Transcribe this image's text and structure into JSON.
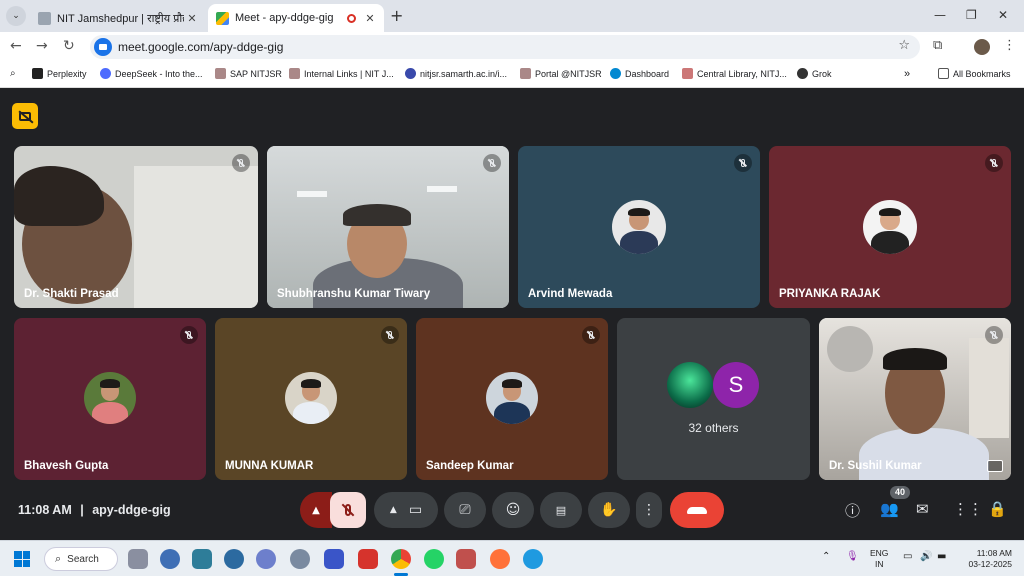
{
  "browser": {
    "tabs": [
      {
        "title": "NIT Jamshedpur | राष्ट्रीय प्रौद्योगिकी",
        "active": false
      },
      {
        "title": "Meet - apy-ddge-gig",
        "active": true
      }
    ],
    "url": "meet.google.com/apy-ddge-gig",
    "bookmarks": [
      "Perplexity",
      "DeepSeek - Into the...",
      "SAP NITJSR",
      "Internal Links | NIT J...",
      "nitjsr.samarth.ac.in/i...",
      "Portal @NITJSR",
      "Dashboard",
      "Central Library, NITJ...",
      "Grok"
    ],
    "all_bookmarks_label": "All Bookmarks",
    "more_bookmarks": "»"
  },
  "meet": {
    "tiles_row1": [
      {
        "name": "Dr. Shakti Prasad",
        "type": "video",
        "color": "#cfd0cc"
      },
      {
        "name": "Shubhranshu Kumar Tiwary",
        "type": "video",
        "color": "#b9bfbf"
      },
      {
        "name": "Arvind Mewada",
        "type": "avatar",
        "color": "#2d4a5b"
      },
      {
        "name": "PRIYANKA RAJAK",
        "type": "avatar",
        "color": "#6b2830"
      }
    ],
    "tiles_row2": [
      {
        "name": "Bhavesh Gupta",
        "type": "avatar",
        "color": "#5d2233"
      },
      {
        "name": "MUNNA KUMAR",
        "type": "avatar",
        "color": "#5a4526"
      },
      {
        "name": "Sandeep Kumar",
        "type": "avatar",
        "color": "#5e3320"
      },
      {
        "name": "Dr. Sushil Kumar",
        "type": "video",
        "color": "#c8c6c2"
      }
    ],
    "others_label": "32 others",
    "others_initial": "S",
    "meeting_time": "11:08 AM",
    "separator": "|",
    "meeting_code": "apy-ddge-gig",
    "participants_count": "40"
  },
  "taskbar": {
    "search_label": "Search",
    "lang_line1": "ENG",
    "lang_line2": "IN",
    "time": "11:08 AM",
    "date": "03-12-2025"
  },
  "colors": {
    "meet_bg": "#202124",
    "hangup": "#ea4335",
    "mic_muted_bg": "#f9dedc",
    "accent": "#1a73e8"
  }
}
